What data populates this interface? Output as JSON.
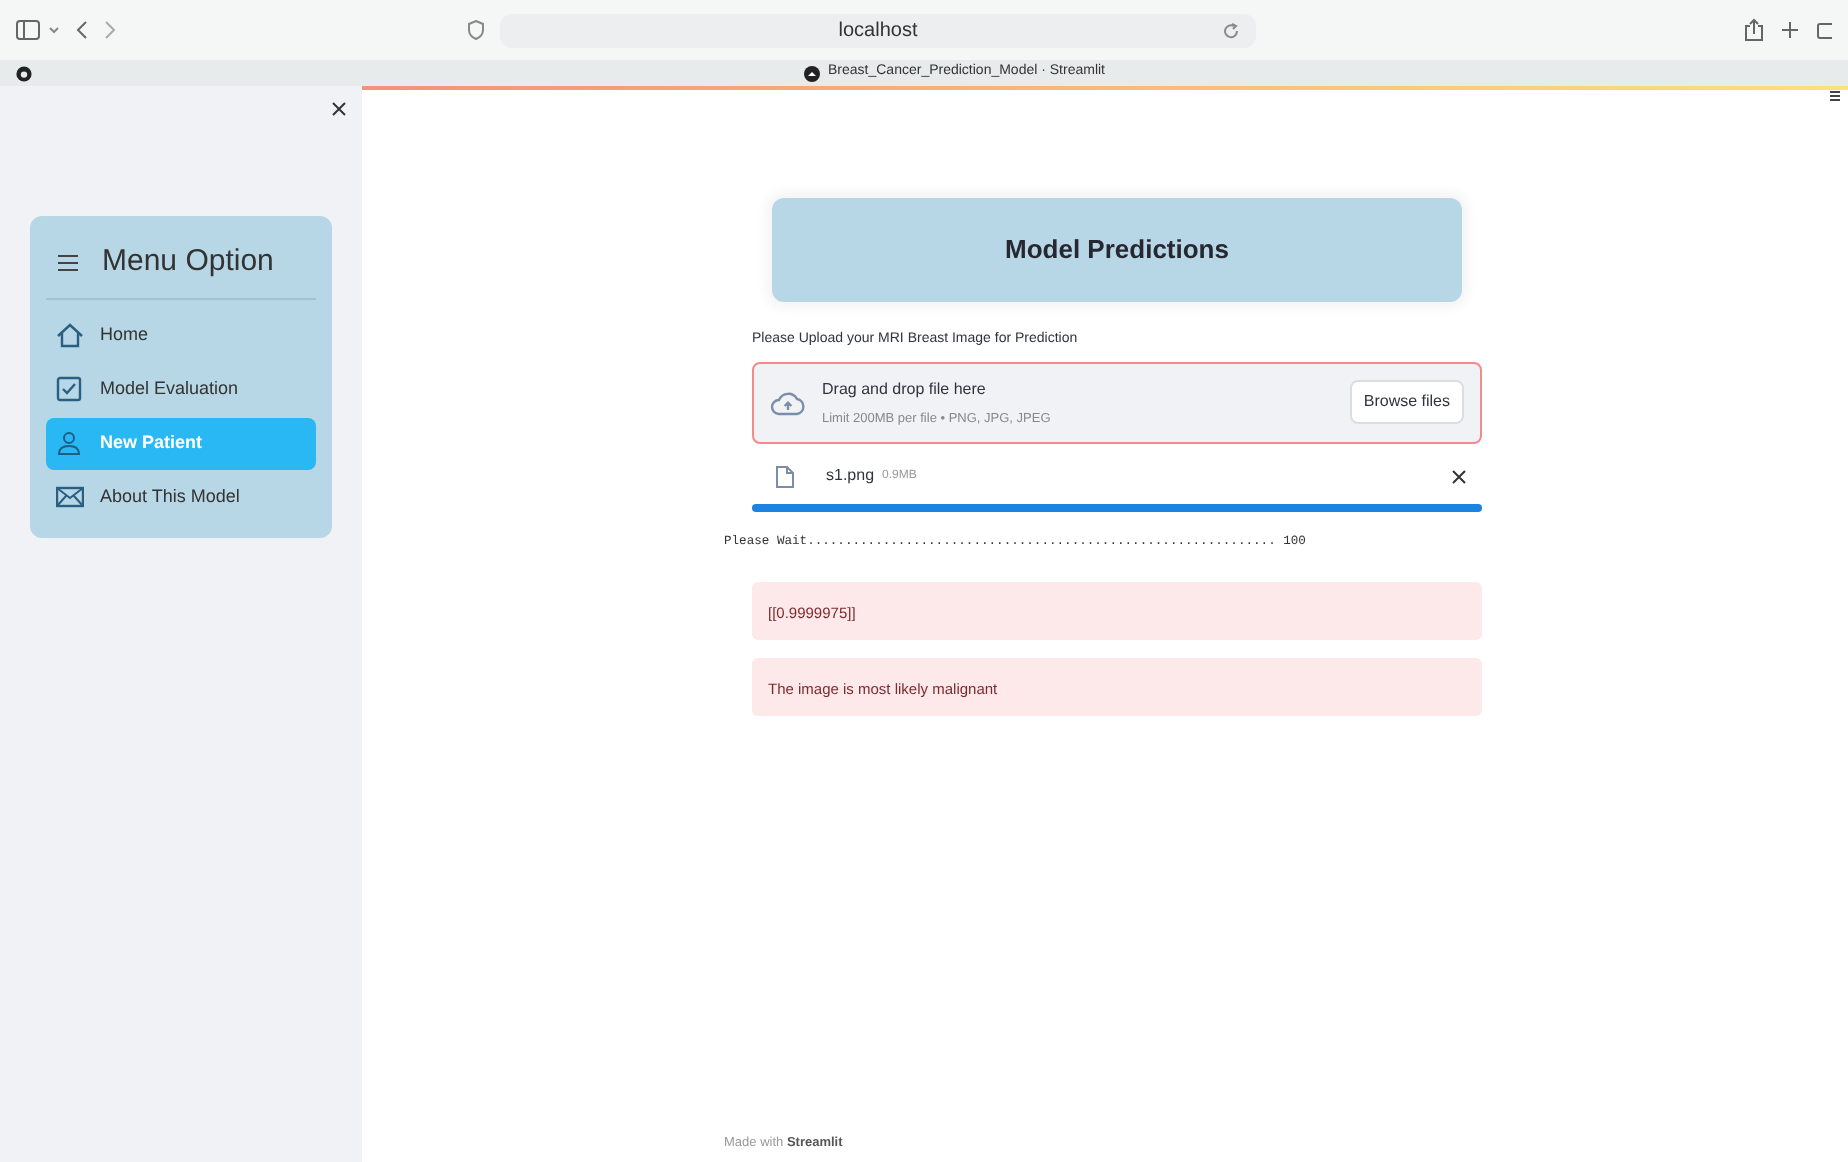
{
  "browser": {
    "address": "localhost",
    "tab_title": "Breast_Cancer_Prediction_Model · Streamlit"
  },
  "sidebar": {
    "menu_title": "Menu Option",
    "items": [
      {
        "label": "Home",
        "selected": false
      },
      {
        "label": "Model Evaluation",
        "selected": false
      },
      {
        "label": "New Patient",
        "selected": true
      },
      {
        "label": "About This Model",
        "selected": false
      }
    ]
  },
  "main": {
    "header": "Model Predictions",
    "uploader": {
      "label": "Please Upload your MRI Breast Image for Prediction",
      "drop_text": "Drag and drop file here",
      "limit_text": "Limit 200MB per file • PNG, JPG, JPEG",
      "button": "Browse files"
    },
    "file": {
      "name": "s1.png",
      "size": "0.9MB"
    },
    "progress": {
      "level": 1.0
    },
    "log": "Please Wait.............................................................. 100",
    "alerts": [
      "[[0.9999975]]",
      "The image is most likely malignant"
    ],
    "footer": "Made with **Streamlit**"
  }
}
